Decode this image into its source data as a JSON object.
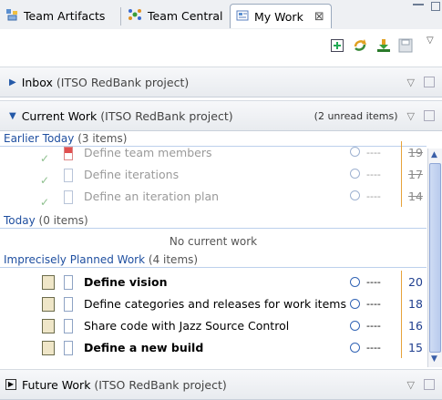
{
  "tabs": [
    {
      "label": "Team Artifacts",
      "icon": "team-artifacts-icon"
    },
    {
      "label": "Team Central",
      "icon": "team-central-icon"
    },
    {
      "label": "My Work",
      "icon": "my-work-icon",
      "active": true,
      "close": "⊠"
    }
  ],
  "toolbar": {
    "icons": [
      "add-icon",
      "refresh-icon",
      "download-icon",
      "save-icon"
    ]
  },
  "sections": {
    "inbox": {
      "title": "Inbox",
      "project": "(ITSO RedBank project)"
    },
    "current": {
      "title": "Current Work",
      "project": "(ITSO RedBank project)",
      "unread": "(2 unread items)"
    },
    "future": {
      "title": "Future Work",
      "project": "(ITSO RedBank project)"
    }
  },
  "groups": {
    "earlier": {
      "title": "Earlier Today",
      "count": "(3 items)"
    },
    "today": {
      "title": "Today",
      "count": "(0 items)",
      "empty": "No current work"
    },
    "imprecise": {
      "title": "Imprecisely Planned Work",
      "count": "(4 items)"
    }
  },
  "earlier_items": [
    {
      "label": "Define team members",
      "time": "----",
      "size": "19"
    },
    {
      "label": "Define iterations",
      "time": "----",
      "size": "17"
    },
    {
      "label": "Define an iteration plan",
      "time": "----",
      "size": "14"
    }
  ],
  "imprecise_items": [
    {
      "label": "Define vision",
      "time": "----",
      "size": "20",
      "bold": true
    },
    {
      "label": "Define categories and releases for work items",
      "time": "----",
      "size": "18",
      "bold": false
    },
    {
      "label": "Share code with Jazz Source Control",
      "time": "----",
      "size": "16",
      "bold": false
    },
    {
      "label": "Define a new build",
      "time": "----",
      "size": "15",
      "bold": true
    }
  ],
  "colors": {
    "accent": "#2459a8",
    "highlight": "#e7a33a"
  }
}
